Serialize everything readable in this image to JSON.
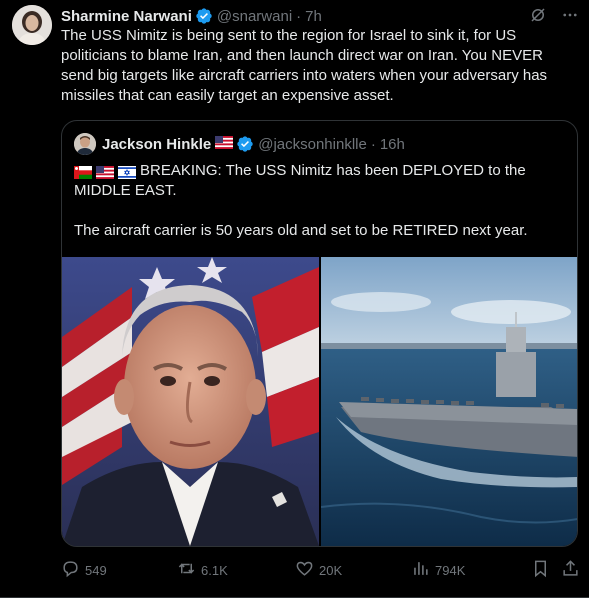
{
  "author": {
    "name": "Sharmine Narwani",
    "handle": "@snarwani",
    "separator": "·",
    "time": "7h"
  },
  "tweet": {
    "text": "The USS Nimitz is being sent to the region for Israel to sink it, for US politicians to blame Iran, and then launch direct war on Iran. You NEVER send big targets like aircraft carriers into waters when your adversary has missiles that can easily target an expensive asset."
  },
  "quote": {
    "name": "Jackson Hinkle",
    "handle": "@jacksonhinklle",
    "separator": "·",
    "time": "16h",
    "line1": "BREAKING: The USS Nimitz has been DEPLOYED to the",
    "line2": "MIDDLE EAST.",
    "line3": "The aircraft carrier is 50 years old and set to be RETIRED next year."
  },
  "actions": {
    "replies": "549",
    "retweets": "6.1K",
    "likes": "20K",
    "views": "794K"
  },
  "colors": {
    "background": "#000000",
    "text": "#e7e9ea",
    "muted": "#71767b",
    "verified": "#1d9bf0",
    "border": "#2f3336"
  }
}
